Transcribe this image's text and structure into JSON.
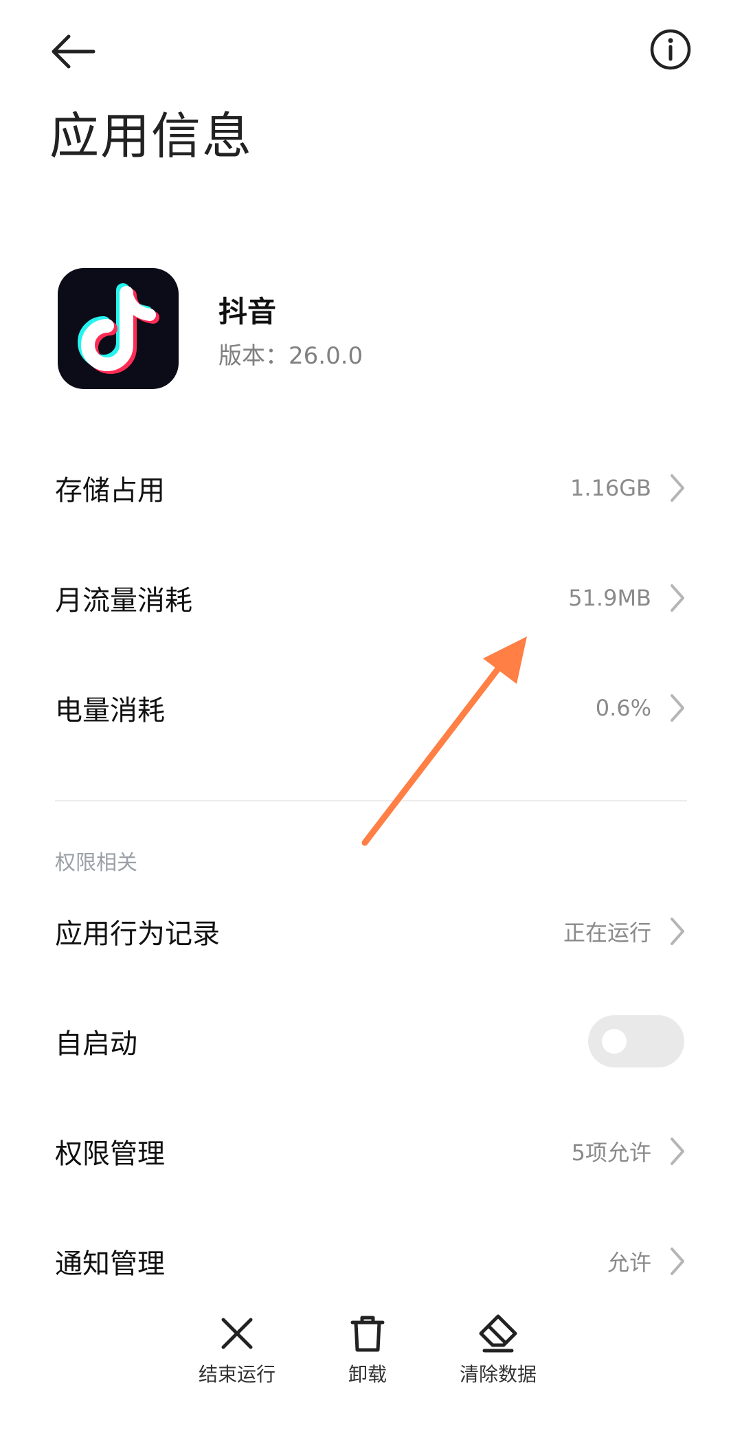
{
  "header": {
    "title": "应用信息",
    "back_icon": "arrow-left-icon",
    "info_icon": "info-circle-icon"
  },
  "app": {
    "name": "抖音",
    "version": "版本：26.0.0",
    "icon": "tiktok-logo-icon"
  },
  "usage_rows": [
    {
      "label": "存储占用",
      "value": "1.16GB"
    },
    {
      "label": "月流量消耗",
      "value": "51.9MB"
    },
    {
      "label": "电量消耗",
      "value": "0.6%"
    }
  ],
  "permissions": {
    "section_title": "权限相关",
    "rows": [
      {
        "label": "应用行为记录",
        "value": "正在运行"
      },
      {
        "label": "自启动",
        "toggle_on": false
      },
      {
        "label": "权限管理",
        "value": "5项允许"
      },
      {
        "label": "通知管理",
        "value": "允许"
      }
    ]
  },
  "bottom_actions": [
    {
      "label": "结束运行",
      "icon": "close-x-icon"
    },
    {
      "label": "卸载",
      "icon": "trash-icon"
    },
    {
      "label": "清除数据",
      "icon": "eraser-icon"
    }
  ],
  "colors": {
    "annotation_arrow": "#ff7f45",
    "toggle_off_track": "#e9e9e9",
    "secondary_text": "#8a8a8a",
    "section_title": "#9aa0a6"
  }
}
